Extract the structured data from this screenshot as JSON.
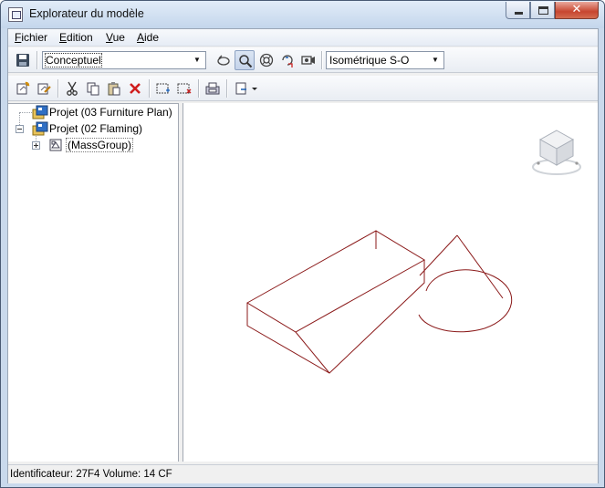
{
  "window": {
    "title": "Explorateur du modèle",
    "close_glyph": "✕"
  },
  "menu": {
    "items": [
      {
        "label": "Fichier",
        "accel": "F",
        "rest": "ichier"
      },
      {
        "label": "Edition",
        "accel": "E",
        "rest": "dition"
      },
      {
        "label": "Vue",
        "accel": "V",
        "rest": "ue"
      },
      {
        "label": "Aide",
        "accel": "A",
        "rest": "ide"
      }
    ]
  },
  "toolbar": {
    "visual_style": {
      "selected": "Conceptuel"
    },
    "view_direction": {
      "selected": "Isométrique S-O"
    },
    "dropdown_glyph": "▼",
    "icons": [
      "save-icon",
      "orbit-icon",
      "zoom-icon",
      "zoom-extents-icon",
      "rotate-view-icon",
      "camera-icon"
    ],
    "edit_icons": [
      "new-item-icon",
      "edit-item-icon",
      "cut-icon",
      "copy-icon",
      "paste-icon",
      "delete-icon",
      "select-add-icon",
      "select-remove-icon",
      "properties-icon",
      "export-icon"
    ],
    "active_tool": "zoom"
  },
  "tree": {
    "items": [
      {
        "label": "Projet (03 Furniture Plan)",
        "level": 0,
        "expanded": false,
        "icon": "project-icon"
      },
      {
        "label": "Projet (02 Flaming)",
        "level": 0,
        "expanded": true,
        "icon": "project-icon"
      },
      {
        "label": "(MassGroup)",
        "level": 1,
        "expanded": false,
        "icon": "massgroup-icon",
        "selected": true
      }
    ]
  },
  "viewport": {
    "line_color": "#8b1a1a",
    "viewcube_icon": "viewcube-icon"
  },
  "status": {
    "text": "Identificateur: 27F4  Volume: 14 CF"
  }
}
